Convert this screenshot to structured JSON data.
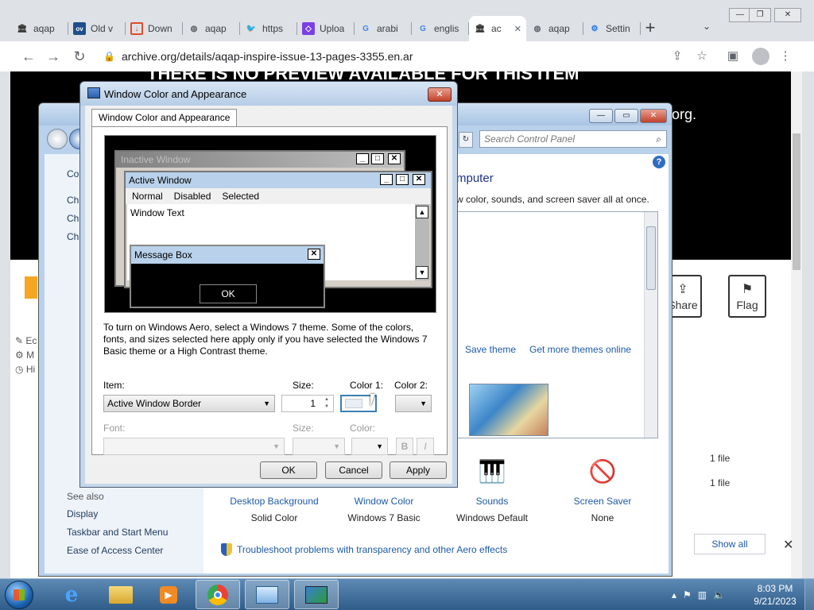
{
  "browser": {
    "tabs": [
      {
        "title": "aqap",
        "icon": "archive-icon",
        "icon_color": "#333333"
      },
      {
        "title": "Old v",
        "icon": "ov-icon",
        "icon_color": "#1f4e8c"
      },
      {
        "title": "Down",
        "icon": "pdf-icon",
        "icon_color": "#e04b2a"
      },
      {
        "title": "aqap",
        "icon": "globe-icon",
        "icon_color": "#5f6368"
      },
      {
        "title": "https",
        "icon": "twitter-icon",
        "icon_color": "#1d9bf0"
      },
      {
        "title": "Uploa",
        "icon": "upload-icon",
        "icon_color": "#7b3fe4"
      },
      {
        "title": "arabi",
        "icon": "google-icon",
        "icon_color": "#4285f4"
      },
      {
        "title": "englis",
        "icon": "google-icon",
        "icon_color": "#4285f4"
      },
      {
        "title": "ac",
        "icon": "archive-icon",
        "icon_color": "#333333",
        "active": true
      },
      {
        "title": "aqap",
        "icon": "globe-icon",
        "icon_color": "#5f6368"
      },
      {
        "title": "Settin",
        "icon": "settings-icon",
        "icon_color": "#1a73e8"
      }
    ],
    "url": "archive.org/details/aqap-inspire-issue-13-pages-3355.en.ar"
  },
  "page": {
    "banner_text": "THERE IS NO PREVIEW AVAILABLE FOR THIS ITEM",
    "banner_tail": "org.",
    "share_label": "Share",
    "flag_label": "Flag",
    "file_rows": [
      "1 file",
      "1 file"
    ],
    "left_labels": [
      "Ec",
      "M",
      "Hi"
    ]
  },
  "control_panel": {
    "search_placeholder": "Search Control Panel",
    "heading": "mputer",
    "subtext": "w color, sounds, and screen saver all at once.",
    "left_links": [
      "Co",
      "Ch",
      "Ch",
      "Ch"
    ],
    "see_also": "See also",
    "see_also_links": [
      "Display",
      "Taskbar and Start Menu",
      "Ease of Access Center"
    ],
    "save_theme": "Save theme",
    "more_themes": "Get more themes online",
    "items": [
      {
        "link": "Desktop Background",
        "value": "Solid Color"
      },
      {
        "link": "Window Color",
        "value": "Windows 7 Basic"
      },
      {
        "link": "Sounds",
        "value": "Windows Default"
      },
      {
        "link": "Screen Saver",
        "value": "None"
      }
    ],
    "troubleshoot": "Troubleshoot problems with transparency and other Aero effects",
    "show_all": "Show all"
  },
  "dialog": {
    "title": "Window Color and Appearance",
    "tab": "Window Color and Appearance",
    "preview": {
      "inactive_title": "Inactive Window",
      "active_title": "Active Window",
      "menu": [
        "Normal",
        "Disabled",
        "Selected"
      ],
      "window_text": "Window Text",
      "message_box_title": "Message Box",
      "message_box_ok": "OK"
    },
    "note": "To turn on Windows Aero, select a Windows 7 theme.  Some of the colors, fonts, and sizes selected here apply only if you have selected the Windows 7 Basic theme or a High Contrast theme.",
    "item_label": "Item:",
    "item_value": "Active Window Border",
    "size_label": "Size:",
    "size_value": "1",
    "color1_label": "Color 1:",
    "color2_label": "Color 2:",
    "font_label": "Font:",
    "font_size_label": "Size:",
    "font_color_label": "Color:",
    "bold_label": "B",
    "italic_label": "I",
    "ok": "OK",
    "cancel": "Cancel",
    "apply": "Apply"
  },
  "taskbar": {
    "time": "8:03 PM",
    "date": "9/21/2023"
  }
}
